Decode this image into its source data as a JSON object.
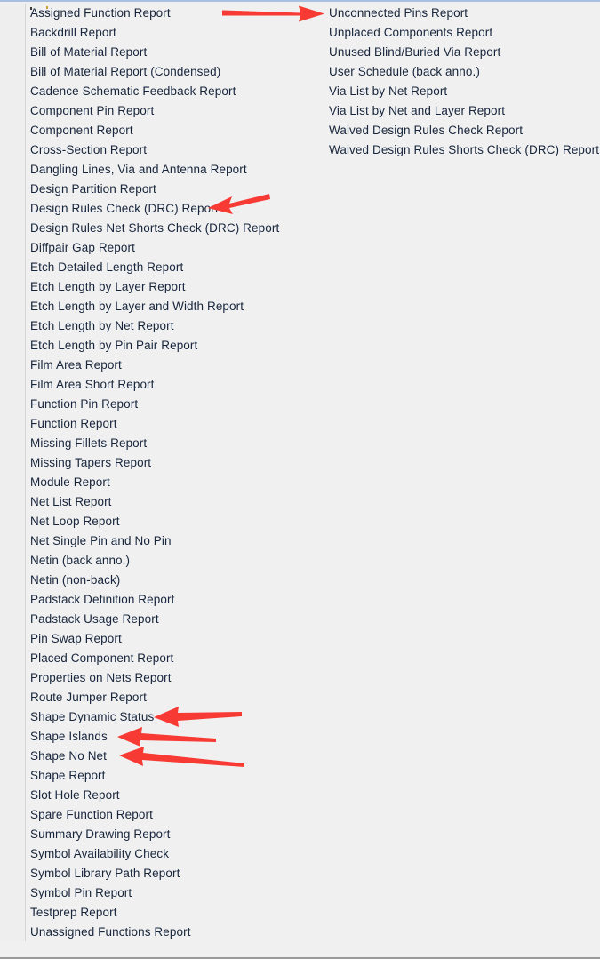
{
  "panel": {
    "name": "reports-list-panel",
    "background_color": "#f0f0f0",
    "top_border_color": "#a8c0e0",
    "bottom_border_color": "#9a9a9a",
    "divider_color": "#d6d6d6"
  },
  "annotations": {
    "arrow_color": "#f83a34",
    "arrows": [
      {
        "label": "arrow-to-unconnected-pins-report",
        "direction": "right",
        "target": "Unconnected Pins Report"
      },
      {
        "label": "arrow-to-design-rules-check-drc-report",
        "direction": "left",
        "target": "Design Rules Check (DRC) Report"
      },
      {
        "label": "arrow-to-shape-dynamic-status",
        "direction": "left",
        "target": "Shape Dynamic Status"
      },
      {
        "label": "arrow-to-shape-islands",
        "direction": "left",
        "target": "Shape Islands"
      },
      {
        "label": "arrow-to-shape-no-net",
        "direction": "left",
        "target": "Shape No Net"
      }
    ]
  },
  "list": {
    "left_column": [
      "Assigned Function Report",
      "Backdrill Report",
      "Bill of Material Report",
      "Bill of Material Report (Condensed)",
      "Cadence Schematic Feedback Report",
      "Component Pin Report",
      "Component Report",
      "Cross-Section Report",
      "Dangling Lines, Via and Antenna Report",
      "Design Partition Report",
      "Design Rules Check (DRC) Report",
      "Design Rules Net Shorts Check (DRC) Report",
      "Diffpair Gap Report",
      "Etch Detailed Length Report",
      "Etch Length by Layer Report",
      "Etch Length by Layer and Width Report",
      "Etch Length by Net Report",
      "Etch Length by Pin Pair Report",
      "Film Area Report",
      "Film Area Short Report",
      "Function Pin Report",
      "Function Report",
      "Missing Fillets Report",
      "Missing Tapers Report",
      "Module Report",
      "Net List Report",
      "Net Loop Report",
      "Net Single Pin and No Pin",
      "Netin (back anno.)",
      "Netin (non-back)",
      "Padstack Definition Report",
      "Padstack Usage Report",
      "Pin Swap Report",
      "Placed Component Report",
      "Properties on Nets Report",
      "Route Jumper Report",
      "Shape Dynamic Status",
      "Shape Islands",
      "Shape No Net",
      "Shape Report",
      "Slot Hole Report",
      "Spare Function Report",
      "Summary Drawing Report",
      "Symbol Availability Check",
      "Symbol Library Path Report",
      "Symbol Pin Report",
      "Testprep Report",
      "Unassigned Functions Report"
    ],
    "right_column": [
      "Unconnected Pins Report",
      "Unplaced Components Report",
      "Unused Blind/Buried Via Report",
      "User Schedule (back anno.)",
      "Via List by Net Report",
      "Via List by Net and Layer Report",
      "Waived Design Rules Check Report",
      "Waived Design Rules Shorts Check (DRC) Report"
    ]
  }
}
